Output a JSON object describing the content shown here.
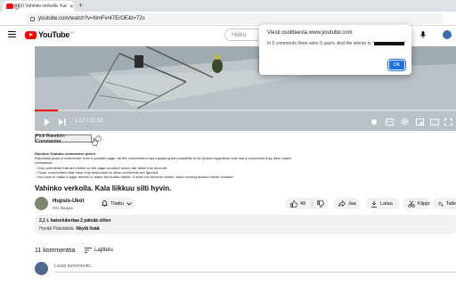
{
  "browser": {
    "tab_title": "(60) Vahinko verkolla. Kala",
    "url": "youtube.com/watch?v=NmFvr47ErOE&t=72s"
  },
  "youtube": {
    "logo_text": "YouTube",
    "logo_country": "FI",
    "search_placeholder": "Haku"
  },
  "player": {
    "current_time": "1:12",
    "duration": "22:18",
    "time_display": "1:12 / 22:18",
    "progress_fraction": 0.054
  },
  "dialog": {
    "title": "Viesti osoitteesta www.youtube.com",
    "message": "In 5 comments there were 5 users. And the winner is \"",
    "message_end": "\"",
    "ok_label": "OK"
  },
  "picker": {
    "button_label": "Pick Random Commenter",
    "help_label": "?",
    "info_title": "Random Youtube commenter picker",
    "info_lines": [
      "Randomly picks a commenter from a youtube page. All the commenters has equally great possibility to be picked regardless how many comments they have made.",
      "Limitations:",
      "- Only comments that are visible on the page (scrolled down) are taken into account.",
      "- Those commenters that have only responded to other comments are ignored.",
      "- You have to make a page refresh to make the button visible. It does not become visible, when moving around inside Youtube."
    ]
  },
  "video": {
    "title": "Vahinko verkolla. Kala liikkuu siltì hyvin.",
    "channel_name": "Hupsis-Ukot",
    "subscribers": "901 tilaajaa",
    "subscribe_label": "Tilattu",
    "like_count": "49",
    "share_label": "Jaa",
    "download_label": "Lataa",
    "clip_label": "Klippi",
    "save_label": "Talle"
  },
  "description": {
    "meta": "2,1 t. katselukertaa  2 päivää sitten",
    "text": "Hyvää Pääsiäistä.",
    "more_label": "Näytä lisää"
  },
  "comments": {
    "count_label": "11 kommenttia",
    "sort_label": "Lajittelu",
    "add_placeholder": "Lisää kommentti..."
  },
  "colors": {
    "accent": "#1a73e8",
    "brand_red": "#ff0000"
  }
}
